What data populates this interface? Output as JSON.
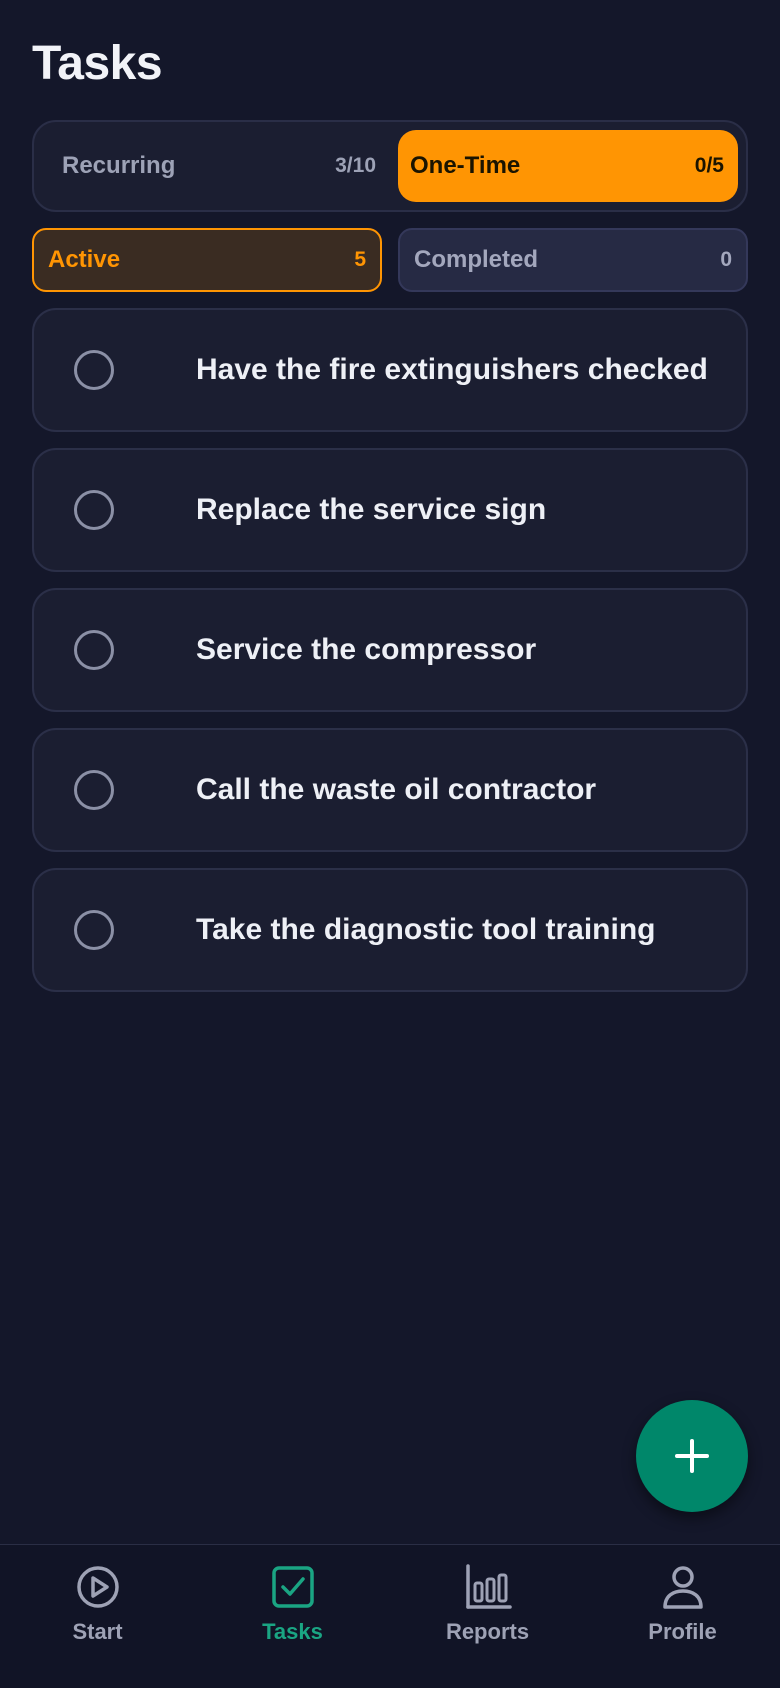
{
  "header": {
    "title": "Tasks"
  },
  "segment": {
    "recurring": {
      "label": "Recurring",
      "count": "3/10"
    },
    "one_time": {
      "label": "One-Time",
      "count": "0/5"
    },
    "selected": "one_time"
  },
  "filters": {
    "active": {
      "label": "Active",
      "count": "5"
    },
    "completed": {
      "label": "Completed",
      "count": "0"
    }
  },
  "tasks": [
    {
      "text": "Have the fire extinguishers checked",
      "done": false
    },
    {
      "text": "Replace the service sign",
      "done": false
    },
    {
      "text": "Service the compressor",
      "done": false
    },
    {
      "text": "Call the waste oil contractor",
      "done": false
    },
    {
      "text": "Take the diagnostic tool training",
      "done": false
    }
  ],
  "fab": {
    "icon": "plus-icon"
  },
  "nav": {
    "items": [
      {
        "label": "Start",
        "icon": "play-circle-icon"
      },
      {
        "label": "Tasks",
        "icon": "checkbox-icon"
      },
      {
        "label": "Reports",
        "icon": "bar-chart-icon"
      },
      {
        "label": "Profile",
        "icon": "person-icon"
      }
    ],
    "selected": "Tasks"
  },
  "colors": {
    "background": "#14172a",
    "accent_orange": "#ff9503",
    "accent_green": "#00876a",
    "nav_selected": "#1aa583"
  }
}
